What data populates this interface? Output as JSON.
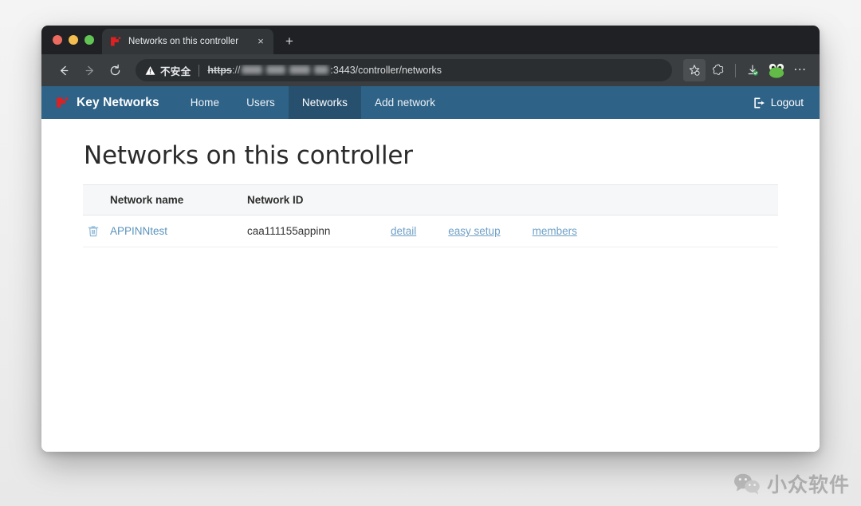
{
  "browser": {
    "traffic_lights": [
      "close",
      "minimize",
      "zoom"
    ],
    "tab": {
      "title": "Networks on this controller",
      "favicon": "key-networks-logo-icon",
      "close_label": "×"
    },
    "new_tab_label": "+",
    "toolbar": {
      "back_icon": "back-arrow-icon",
      "forward_icon": "forward-arrow-icon",
      "reload_icon": "reload-icon",
      "security_label": "不安全",
      "security_icon": "warning-triangle-icon",
      "url_scheme": "https",
      "url_separator": "://",
      "url_host_redacted": true,
      "url_rest": ":3443/controller/networks",
      "right_icons": [
        "favorites-star-icon",
        "collections-icon",
        "downloads-icon",
        "profile-avatar-icon",
        "more-settings-icon"
      ]
    }
  },
  "site_nav": {
    "brand": "Key Networks",
    "brand_logo": "key-networks-logo-icon",
    "items": [
      {
        "label": "Home",
        "active": false
      },
      {
        "label": "Users",
        "active": false
      },
      {
        "label": "Networks",
        "active": true
      },
      {
        "label": "Add network",
        "active": false
      }
    ],
    "logout_label": "Logout",
    "logout_icon": "sign-out-icon",
    "bg_color": "#2e6287",
    "active_bg_color": "#27506e"
  },
  "main": {
    "page_title": "Networks on this controller",
    "table": {
      "columns": [
        "",
        "Network name",
        "Network ID",
        "",
        "",
        ""
      ],
      "headers": {
        "name": "Network name",
        "id": "Network ID"
      },
      "rows": [
        {
          "delete_icon": "trash-icon",
          "network_name": "APPINNtest",
          "network_id": "caa111155appinn",
          "actions": [
            "detail",
            "easy setup",
            "members"
          ]
        }
      ]
    },
    "link_color": "#6fa0c6"
  },
  "watermark": {
    "icon": "wechat-logo-icon",
    "text": "小众软件"
  }
}
